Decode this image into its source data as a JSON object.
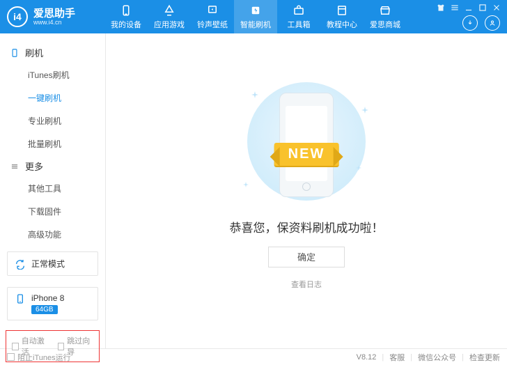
{
  "brand": {
    "name": "爱思助手",
    "domain": "www.i4.cn",
    "logo_text": "i4"
  },
  "nav": [
    {
      "label": "我的设备",
      "icon": "device"
    },
    {
      "label": "应用游戏",
      "icon": "apps"
    },
    {
      "label": "铃声壁纸",
      "icon": "music"
    },
    {
      "label": "智能刷机",
      "icon": "flash",
      "active": true
    },
    {
      "label": "工具箱",
      "icon": "toolbox"
    },
    {
      "label": "教程中心",
      "icon": "book"
    },
    {
      "label": "爱思商城",
      "icon": "shop"
    }
  ],
  "sidebar": {
    "group1": {
      "title": "刷机",
      "items": [
        "iTunes刷机",
        "一键刷机",
        "专业刷机",
        "批量刷机"
      ],
      "activeIndex": 1
    },
    "group2": {
      "title": "更多",
      "items": [
        "其他工具",
        "下载固件",
        "高级功能"
      ]
    },
    "mode": {
      "label": "正常模式"
    },
    "device": {
      "name": "iPhone 8",
      "storage": "64GB"
    },
    "checks": {
      "auto_activate": "自动激活",
      "skip_guide": "跳过向导"
    }
  },
  "content": {
    "ribbon": "NEW",
    "message": "恭喜您，保资料刷机成功啦！",
    "confirm": "确定",
    "view_logs": "查看日志"
  },
  "footer": {
    "block_itunes": "阻止iTunes运行",
    "version": "V8.12",
    "support": "客服",
    "wechat": "微信公众号",
    "check_update": "检查更新"
  }
}
